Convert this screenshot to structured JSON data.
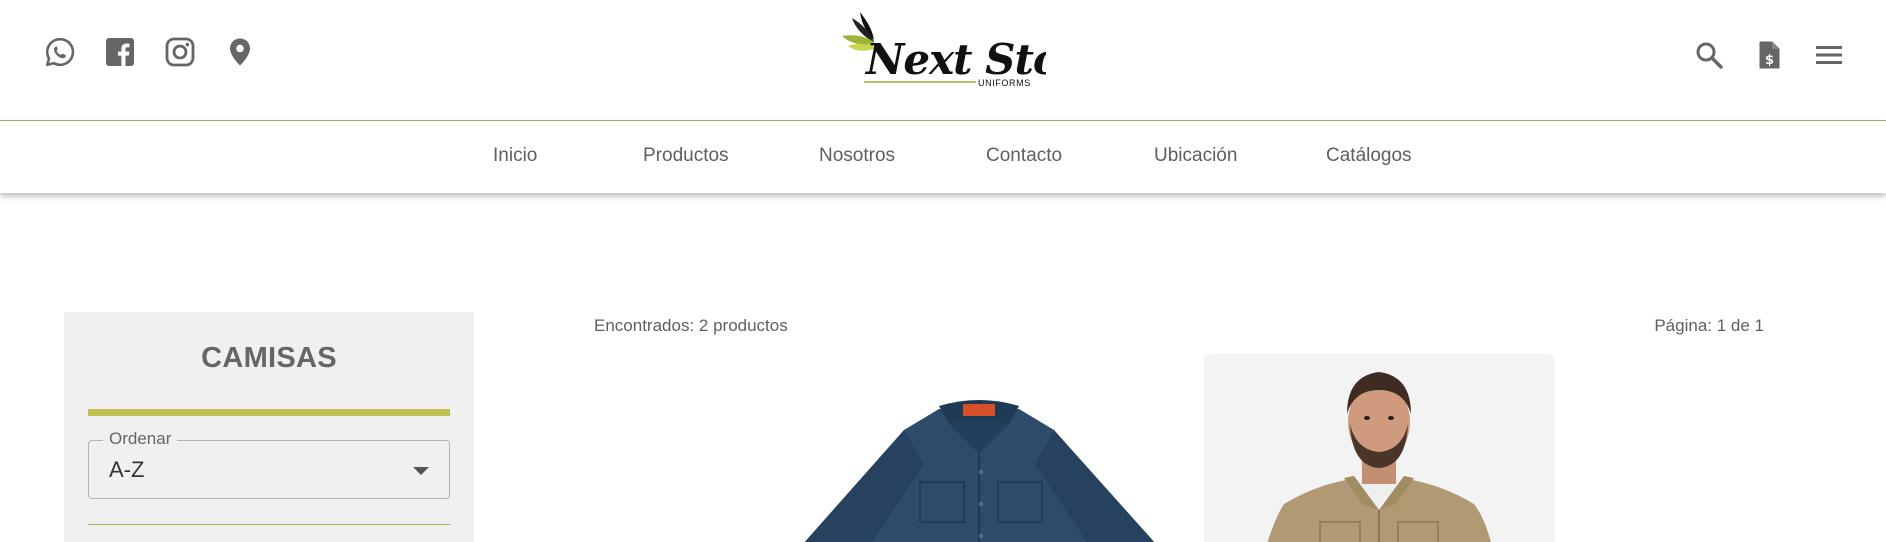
{
  "header": {
    "social_icons": [
      "whatsapp-icon",
      "facebook-icon",
      "instagram-icon",
      "location-icon"
    ],
    "logo_text": "Next Store",
    "logo_subtext": "UNIFORMS",
    "action_icons": [
      "search-icon",
      "quote-document-icon",
      "menu-icon"
    ]
  },
  "nav": {
    "items": [
      {
        "label": "Inicio"
      },
      {
        "label": "Productos"
      },
      {
        "label": "Nosotros"
      },
      {
        "label": "Contacto"
      },
      {
        "label": "Ubicación"
      },
      {
        "label": "Catálogos"
      }
    ]
  },
  "sidebar": {
    "title": "CAMISAS",
    "sort": {
      "label": "Ordenar",
      "value": "A-Z"
    }
  },
  "results": {
    "found_text": "Encontrados: 2 productos",
    "page_text": "Página: 1 de 1"
  },
  "products": [
    {
      "image": "navy-work-shirt"
    },
    {
      "image": "khaki-work-shirt-model"
    }
  ],
  "colors": {
    "accent_olive": "#bfbf52",
    "line_olive": "#a7b35a",
    "icon_gray": "#666666",
    "text_gray": "#5f5f5f",
    "sidebar_bg": "#f0f0f0"
  }
}
